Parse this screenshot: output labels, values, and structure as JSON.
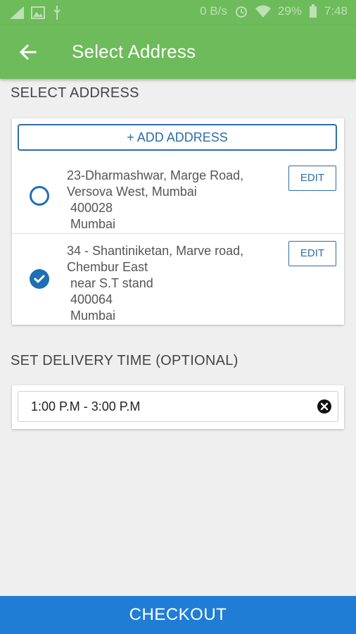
{
  "status_bar": {
    "network_speed": "0 B/s",
    "battery": "29%",
    "time": "7:48"
  },
  "app_bar": {
    "title": "Select Address"
  },
  "address_section": {
    "label": "SELECT ADDRESS",
    "add_button": "+ ADD ADDRESS",
    "addresses": [
      {
        "text": "23-Dharmashwar, Marge Road,\nVersova West, Mumbai\n 400028\n Mumbai",
        "selected": false,
        "edit_label": "EDIT"
      },
      {
        "text": "34 - Shantiniketan, Marve road,\nChembur East\n near S.T stand\n 400064\n Mumbai",
        "selected": true,
        "edit_label": "EDIT"
      }
    ]
  },
  "delivery_time": {
    "label": "SET DELIVERY TIME (OPTIONAL)",
    "value": "1:00 P.M - 3:00 P.M"
  },
  "checkout_label": "CHECKOUT",
  "colors": {
    "app_bar": "#6dbb5a",
    "accent": "#1f6fb4",
    "checkout": "#1f7dd6"
  }
}
